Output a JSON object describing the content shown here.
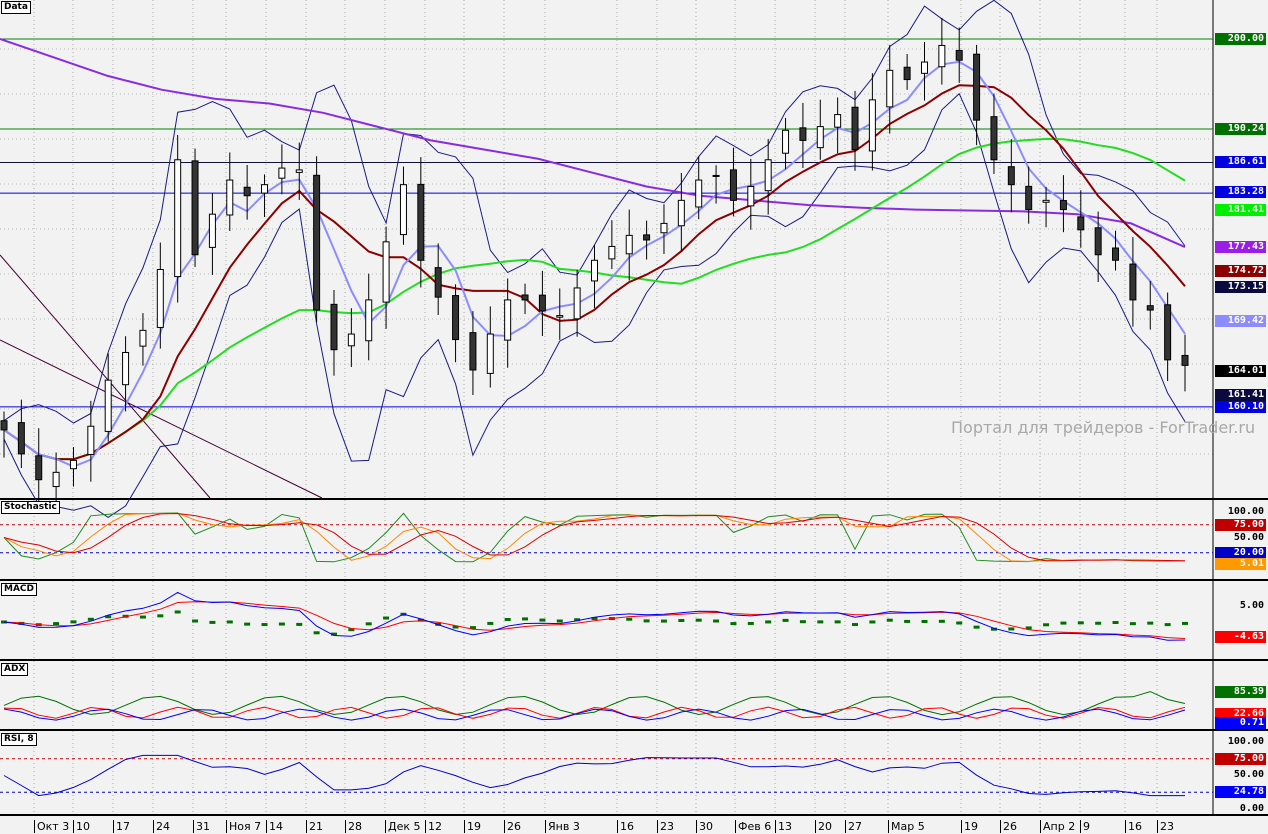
{
  "panels": {
    "main": "Data",
    "stoch": "Stochastic",
    "macd": "MACD",
    "adx": "ADX",
    "rsi": "RSI, 8"
  },
  "watermark": "Портал для трейдеров - ForTrader.ru",
  "price_labels": [
    {
      "text": "200.00",
      "color": "#007000"
    },
    {
      "text": "190.24",
      "color": "#007000"
    },
    {
      "text": "186.61",
      "color": "#0000e0"
    },
    {
      "text": "183.28",
      "color": "#0000e0"
    },
    {
      "text": "181.41",
      "color": "#00ee00"
    },
    {
      "text": "177.43",
      "color": "#9a1ee6"
    },
    {
      "text": "174.72",
      "color": "#8b0000"
    },
    {
      "text": "173.15",
      "color": "#0a0a40"
    },
    {
      "text": "169.42",
      "color": "#8c8cff"
    },
    {
      "text": "164.01",
      "color": "#000000"
    },
    {
      "text": "161.41",
      "color": "#0a0a40"
    },
    {
      "text": "160.10",
      "color": "#0000e0"
    }
  ],
  "stoch_labels": [
    {
      "text": "100.00",
      "color": ""
    },
    {
      "text": "75.00",
      "color": "#c00000"
    },
    {
      "text": "50.00",
      "color": ""
    },
    {
      "text": "20.00",
      "color": "#0000c8"
    },
    {
      "text": "5.01",
      "color": "#ff9900"
    }
  ],
  "macd_labels": [
    {
      "text": "5.00",
      "color": ""
    },
    {
      "text": "-4.63",
      "color": "#ff0000"
    }
  ],
  "adx_labels": [
    {
      "text": "85.39",
      "color": "#007000"
    },
    {
      "text": "22.66",
      "color": "#ff0000"
    },
    {
      "text": "0.71",
      "color": "#0000ff"
    }
  ],
  "rsi_labels": [
    {
      "text": "100.00",
      "color": ""
    },
    {
      "text": "75.00",
      "color": "#c00000"
    },
    {
      "text": "50.00",
      "color": ""
    },
    {
      "text": "24.78",
      "color": "#0000ff"
    },
    {
      "text": "0.00",
      "color": ""
    }
  ],
  "dates": [
    "Окт 3",
    "10",
    "17",
    "24",
    "31",
    "Ноя 7",
    "14",
    "21",
    "28",
    "Дек 5",
    "12",
    "19",
    "26",
    "Янв 3",
    "16",
    "23",
    "30",
    "Фев 6",
    "13",
    "20",
    "27",
    "Мар 5",
    "19",
    "26",
    "Апр 2",
    "9",
    "16",
    "23"
  ],
  "chart_data": {
    "type": "candlestick",
    "title": "Data",
    "ylim": [
      150.2,
      204.2
    ],
    "horizontal_levels": [
      200.0,
      190.24,
      186.61,
      183.28,
      160.1
    ],
    "close": [
      157.6,
      155,
      152.2,
      153,
      154.3,
      158,
      163,
      166,
      168.4,
      175,
      186.9,
      176.6,
      181,
      184.7,
      183,
      184.2,
      186,
      185.8,
      170.6,
      166.3,
      168,
      171.7,
      178,
      184.2,
      176,
      172,
      167.4,
      164.1,
      168,
      171.7,
      171.7,
      170.5,
      170,
      173,
      176,
      177.5,
      178.7,
      178.2,
      180,
      182.5,
      184.7,
      185.2,
      182.5,
      184,
      186.9,
      190.1,
      189,
      190.5,
      191.8,
      188,
      193.4,
      196.6,
      195.6,
      197.5,
      199.3,
      197.7,
      191.2,
      186.9,
      184.2,
      181.5,
      182.5,
      181.5,
      179.3,
      176.6,
      176,
      171.7,
      170.6,
      165.2,
      164.6
    ],
    "ma200": [
      200,
      198,
      196,
      194.5,
      193.5,
      193,
      192,
      190.5,
      189,
      188,
      187,
      185.5,
      184,
      183,
      182.5,
      182,
      181.7,
      181.5,
      181.4,
      181.3,
      181,
      180,
      177.43
    ]
  }
}
